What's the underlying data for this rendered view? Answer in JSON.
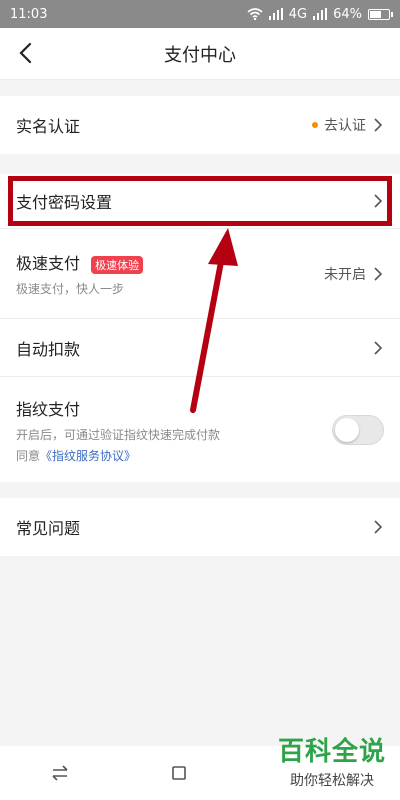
{
  "status": {
    "time": "11:03",
    "network": "4G",
    "battery": "64%",
    "battery_level": 0.64
  },
  "header": {
    "title": "支付中心"
  },
  "identity": {
    "label": "实名认证",
    "action": "去认证"
  },
  "payment_settings": {
    "password": {
      "label": "支付密码设置"
    },
    "fast_pay": {
      "label": "极速支付",
      "badge": "极速体验",
      "subtitle": "极速支付，快人一步",
      "status": "未开启"
    },
    "auto_deduct": {
      "label": "自动扣款"
    },
    "fingerprint": {
      "label": "指纹支付",
      "subtitle": "开启后，可通过验证指纹快速完成付款",
      "agree_prefix": "同意",
      "agreement": "《指纹服务协议》",
      "enabled": false
    }
  },
  "faq": {
    "label": "常见问题"
  },
  "watermark": {
    "main": "百科全说",
    "sub": "助你轻松解决"
  },
  "colors": {
    "accent_dot": "#ff8a00",
    "badge": "#f0424e",
    "link": "#3a6cc3",
    "highlight": "#b40010",
    "watermark": "#2fa34a"
  }
}
